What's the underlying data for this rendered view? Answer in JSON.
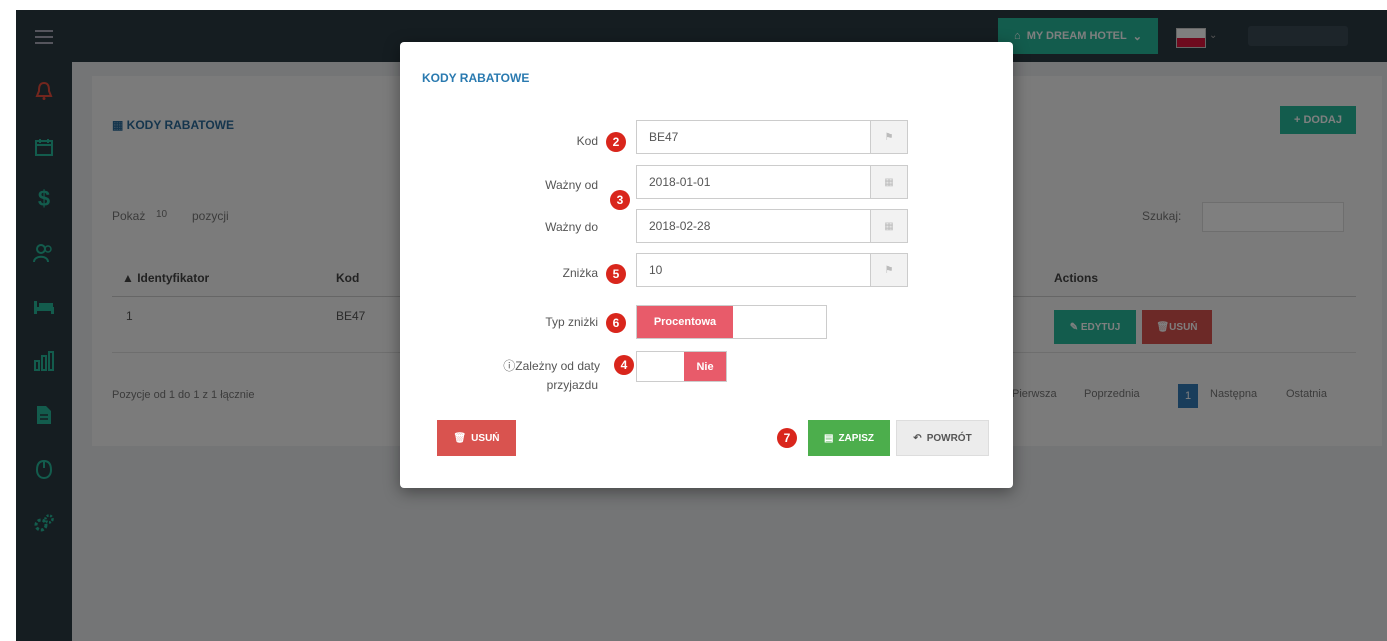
{
  "topbar": {
    "hotel_button": "MY DREAM HOTEL"
  },
  "page": {
    "title": "KODY RABATOWE",
    "add_button": "DODAJ",
    "show_label": "Pokaż",
    "show_value": "10",
    "show_suffix": "pozycji",
    "search_label": "Szukaj:",
    "table": {
      "headers": [
        "Identyfikator",
        "Kod",
        "Actions"
      ],
      "row": {
        "id": "1",
        "code": "BE47"
      },
      "edit_button": "EDYTUJ",
      "delete_button": "USUŃ"
    },
    "footer_info": "Pozycje od 1 do 1 z 1 łącznie",
    "pagination": {
      "first": "Pierwsza",
      "prev": "Poprzednia",
      "current": "1",
      "next": "Następna",
      "last": "Ostatnia"
    }
  },
  "modal": {
    "title": "KODY RABATOWE",
    "fields": {
      "code_label": "Kod",
      "code_value": "BE47",
      "valid_from_label": "Ważny od",
      "valid_from_value": "2018-01-01",
      "valid_to_label": "Ważny do",
      "valid_to_value": "2018-02-28",
      "discount_label": "Zniżka",
      "discount_value": "10",
      "discount_type_label": "Typ zniżki",
      "discount_type_value": "Procentowa",
      "arrival_label_1": "Zależny od daty",
      "arrival_label_2": "przyjazdu",
      "arrival_value": "Nie"
    },
    "buttons": {
      "delete": "USUŃ",
      "save": "ZAPISZ",
      "back": "POWRÓT"
    },
    "badges": {
      "code": "2",
      "dates": "3",
      "discount": "5",
      "type": "6",
      "arrival": "4",
      "save": "7"
    }
  },
  "colors": {
    "accent": "#26b99a",
    "danger": "#d9534f",
    "badge": "#d9261c",
    "toggle_on": "#e85b6a",
    "sidebar": "#2b3a42"
  },
  "icons": [
    "menu-icon",
    "bell-icon",
    "calendar-icon",
    "dollar-icon",
    "users-icon",
    "bed-icon",
    "chart-icon",
    "document-icon",
    "mouse-icon",
    "gears-icon"
  ]
}
